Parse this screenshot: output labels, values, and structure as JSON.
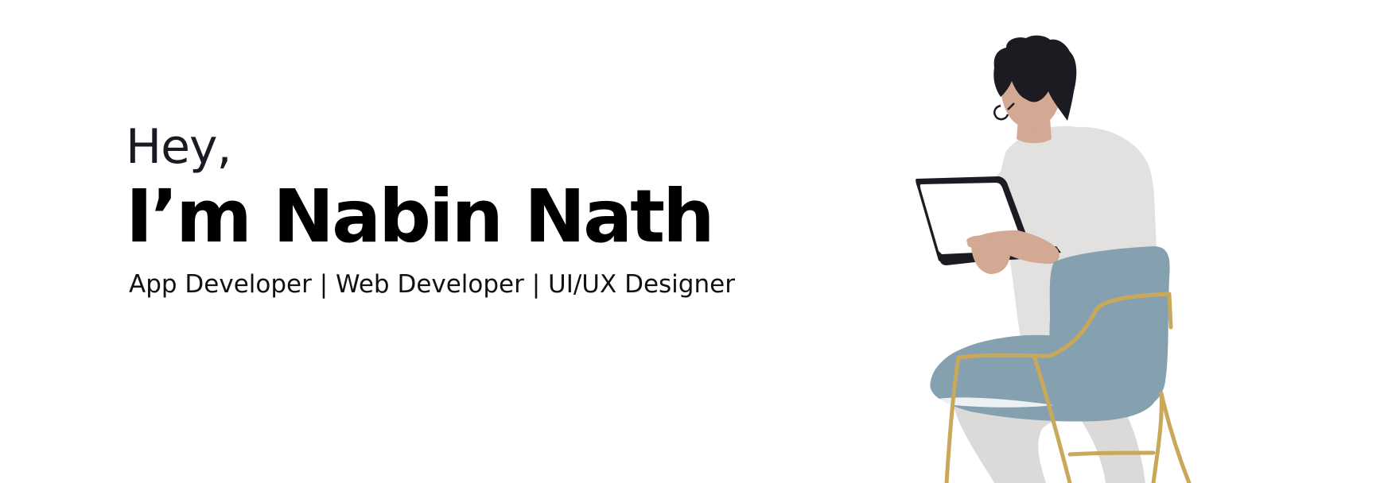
{
  "hero": {
    "greeting": "Hey,",
    "headline": "I’m Nabin Nath",
    "roles": "App Developer | Web Developer | UI/UX Designer"
  },
  "illustration": {
    "icon": "person-working-on-laptop-in-chair",
    "colors": {
      "skin": "#d3a994",
      "hair": "#1b1b21",
      "shirt": "#e3e0e0",
      "pants": "#dcd9d9",
      "chair_cushion": "#85a1b0",
      "chair_frame": "#c9a85a",
      "laptop": "#1b1b21",
      "screen": "#ffffff"
    }
  }
}
